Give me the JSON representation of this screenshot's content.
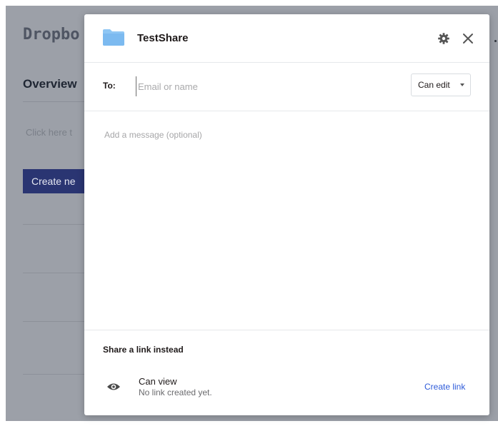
{
  "background": {
    "brand": "Dropbo",
    "section_title": "Overview",
    "hint_text": "Click here t",
    "create_button_label": "Create ne"
  },
  "modal": {
    "folder_name": "TestShare",
    "icons": {
      "folder": "folder-icon",
      "settings": "gear-icon",
      "close": "close-icon",
      "visibility": "eye-icon"
    },
    "to_label": "To:",
    "to_input": {
      "placeholder": "Email or name",
      "value": ""
    },
    "permission": {
      "selected": "Can edit"
    },
    "message": {
      "placeholder": "Add a message (optional)",
      "value": ""
    },
    "share_link": {
      "title": "Share a link instead",
      "permission": "Can view",
      "status": "No link created yet.",
      "create_label": "Create link"
    }
  },
  "colors": {
    "accent_link": "#2e5bd9",
    "folder_blue": "#8ec6f4",
    "overlay_button": "#2a3572"
  }
}
